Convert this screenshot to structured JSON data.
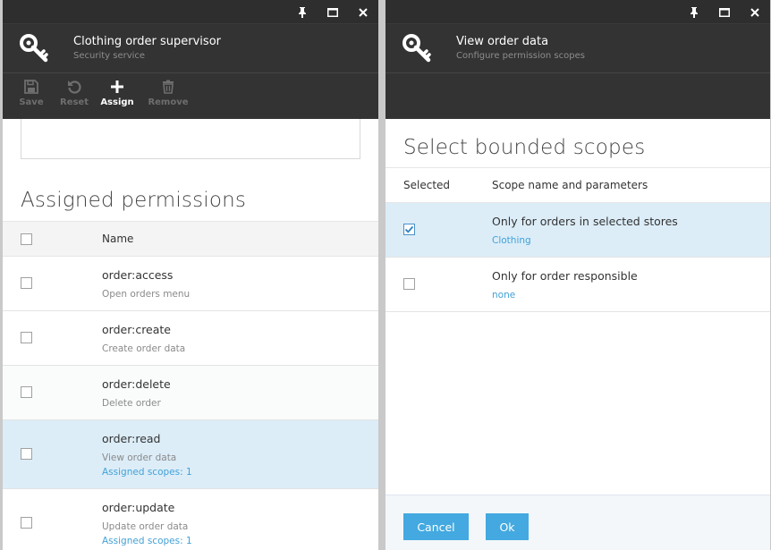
{
  "left_blade": {
    "title": "Clothing order supervisor",
    "subtitle": "Security service",
    "toolbar": {
      "save": "Save",
      "reset": "Reset",
      "assign": "Assign",
      "remove": "Remove"
    },
    "section_title": "Assigned permissions",
    "table": {
      "col_name": "Name",
      "rows": [
        {
          "name": "order:access",
          "description": "Open orders menu",
          "scopes": ""
        },
        {
          "name": "order:create",
          "description": "Create order data",
          "scopes": ""
        },
        {
          "name": "order:delete",
          "description": "Delete order",
          "scopes": ""
        },
        {
          "name": "order:read",
          "description": "View order data",
          "scopes": "Assigned scopes: 1"
        },
        {
          "name": "order:update",
          "description": "Update order data",
          "scopes": "Assigned scopes: 1"
        }
      ]
    }
  },
  "right_blade": {
    "title": "View order data",
    "subtitle": "Configure permission scopes",
    "section_title": "Select bounded scopes",
    "table": {
      "col_selected": "Selected",
      "col_scope": "Scope name and parameters",
      "rows": [
        {
          "name": "Only for orders in selected stores",
          "param": "Clothing",
          "selected": true
        },
        {
          "name": "Only for order responsible",
          "param": "none",
          "selected": false
        }
      ]
    },
    "footer": {
      "cancel": "Cancel",
      "ok": "Ok"
    }
  },
  "icons": {
    "pin": "pin-icon",
    "maximize": "maximize-icon",
    "close": "close-icon",
    "key": "key-icon",
    "save": "save-icon",
    "reset": "reset-icon",
    "assign": "plus-icon",
    "remove": "trash-icon",
    "check": "checkmark-icon"
  },
  "colors": {
    "header_bg": "#333333",
    "accent": "#43a9e0",
    "link": "#43a1d6",
    "selected_row": "#dcedf8"
  }
}
